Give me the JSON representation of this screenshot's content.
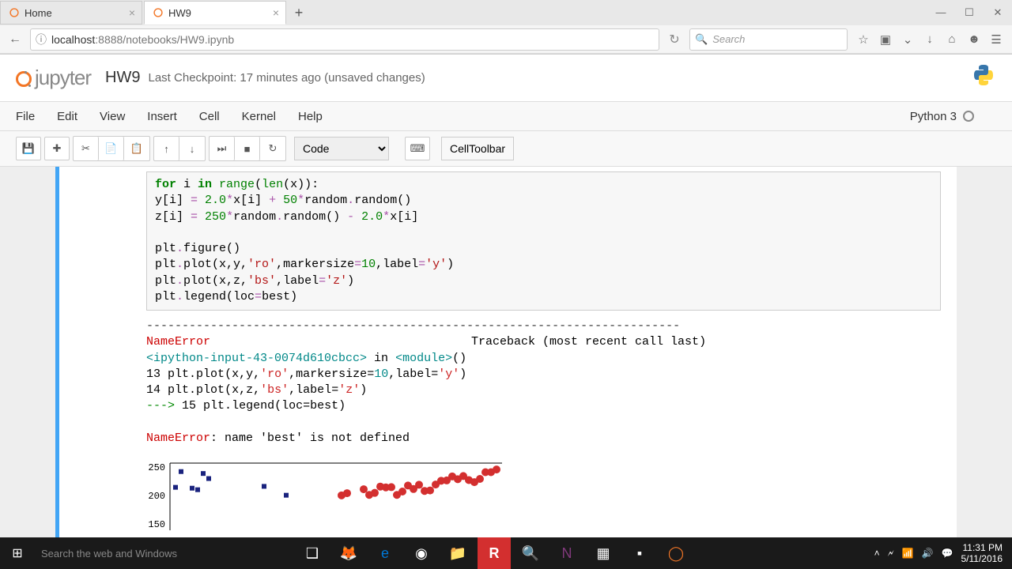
{
  "browser": {
    "tabs": [
      {
        "title": "Home"
      },
      {
        "title": "HW9"
      }
    ],
    "url_host": "localhost",
    "url_path": ":8888/notebooks/HW9.ipynb",
    "search_placeholder": "Search"
  },
  "jupyter": {
    "logo_text": "jupyter",
    "notebook_name": "HW9",
    "checkpoint": "Last Checkpoint: 17 minutes ago (unsaved changes)",
    "menus": [
      "File",
      "Edit",
      "View",
      "Insert",
      "Cell",
      "Kernel",
      "Help"
    ],
    "kernel": "Python 3",
    "cell_type": "Code",
    "celltoolbar": "CellToolbar"
  },
  "code": {
    "l1_for": "for",
    "l1_i": " i ",
    "l1_in": "in",
    "l1_range": " range",
    "l1_len": "len",
    "l1_rest": "(x)):",
    "l2a": "    y[i] ",
    "l2op1": "=",
    "l2b": " ",
    "l2n1": "2.0",
    "l2op2": "*",
    "l2c": "x[i] ",
    "l2op3": "+",
    "l2d": " ",
    "l2n2": "50",
    "l2op4": "*",
    "l2e": "random",
    "l2op5": ".",
    "l2f": "random()",
    "l3a": "    z[i] ",
    "l3op1": "=",
    "l3b": " ",
    "l3n1": "250",
    "l3op2": "*",
    "l3c": "random",
    "l3op3": ".",
    "l3d": "random() ",
    "l3op4": "-",
    "l3e": " ",
    "l3n2": "2.0",
    "l3op5": "*",
    "l3f": "x[i]",
    "l4": "",
    "l5a": "plt",
    "l5b": ".",
    "l5c": "figure()",
    "l6a": "plt",
    "l6b": ".",
    "l6c": "plot(x,y,",
    "l6s": "'ro'",
    "l6d": ",markersize",
    "l6op": "=",
    "l6n": "10",
    "l6e": ",label",
    "l6op2": "=",
    "l6s2": "'y'",
    "l6f": ")",
    "l7a": "plt",
    "l7b": ".",
    "l7c": "plot(x,z,",
    "l7s": "'bs'",
    "l7d": ",label",
    "l7op": "=",
    "l7s2": "'z'",
    "l7e": ")",
    "l8a": "plt",
    "l8b": ".",
    "l8c": "legend(loc",
    "l8op": "=",
    "l8d": "best",
    "l8e": ")"
  },
  "traceback": {
    "dashes": "---------------------------------------------------------------------------",
    "err_name": "NameError",
    "tb_label": "Traceback (most recent call last)",
    "frame_a": "<ipython-input-43-0074d610cbcc>",
    "frame_in": " in ",
    "frame_mod": "<module>",
    "frame_end": "()",
    "l13n": "     13 ",
    "l13a": "plt",
    "l13b": ".",
    "l13c": "plot",
    "l13p1": "(",
    "l13d": "x",
    "l13p2": ",",
    "l13e": "y",
    "l13p3": ",",
    "l13s": "'ro'",
    "l13p4": ",",
    "l13f": "markersize",
    "l13op": "=",
    "l13n2": "10",
    "l13p5": ",",
    "l13g": "label",
    "l13op2": "=",
    "l13s2": "'y'",
    "l13p6": ")",
    "l14n": "     14 ",
    "l14a": "plt",
    "l14b": ".",
    "l14c": "plot",
    "l14p1": "(",
    "l14d": "x",
    "l14p2": ",",
    "l14e": "z",
    "l14p3": ",",
    "l14s": "'bs'",
    "l14p4": ",",
    "l14f": "label",
    "l14op": "=",
    "l14s2": "'z'",
    "l14p5": ")",
    "arrow": "---> ",
    "l15n": "15 ",
    "l15a": "plt",
    "l15b": ".",
    "l15c": "legend",
    "l15p1": "(",
    "l15d": "loc",
    "l15op": "=",
    "l15e": "best",
    "l15p2": ")",
    "final_err": "NameError",
    "final_msg": ": name 'best' is not defined"
  },
  "chart_data": {
    "type": "scatter",
    "y_ticks": [
      150,
      200,
      250
    ],
    "xlim": [
      0,
      100
    ],
    "ylim": [
      0,
      270
    ],
    "series": [
      {
        "name": "y",
        "marker": "ro",
        "color": "#d32f2f"
      },
      {
        "name": "z",
        "marker": "bs",
        "color": "#1a237e"
      }
    ]
  },
  "taskbar": {
    "search": "Search the web and Windows",
    "time": "11:31 PM",
    "date": "5/11/2016"
  }
}
